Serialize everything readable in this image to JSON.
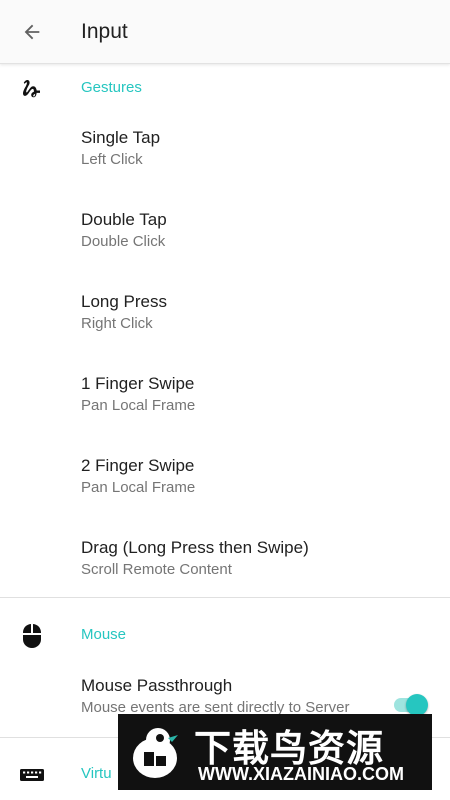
{
  "app_bar": {
    "title": "Input",
    "back_icon": "arrow-back-icon"
  },
  "sections": {
    "gestures": {
      "title": "Gestures",
      "icon": "gesture-icon",
      "items": [
        {
          "title": "Single Tap",
          "summary": "Left Click"
        },
        {
          "title": "Double Tap",
          "summary": "Double Click"
        },
        {
          "title": "Long Press",
          "summary": "Right Click"
        },
        {
          "title": "1 Finger Swipe",
          "summary": "Pan Local Frame"
        },
        {
          "title": "2 Finger Swipe",
          "summary": "Pan Local Frame"
        },
        {
          "title": "Drag (Long Press then Swipe)",
          "summary": "Scroll Remote Content"
        }
      ]
    },
    "mouse": {
      "title": "Mouse",
      "icon": "mouse-icon",
      "items": [
        {
          "title": "Mouse Passthrough",
          "summary": "Mouse events are sent directly to Server",
          "toggle_on": true
        }
      ]
    },
    "virtual_keyboard": {
      "title": "Virtu",
      "icon": "keyboard-icon"
    }
  },
  "colors": {
    "accent": "#26c6c0",
    "primary_text": "#212121",
    "secondary_text": "#757575"
  },
  "watermark": {
    "text": "下载鸟资源",
    "url": "WWW.XIAZAINIAO.COM"
  }
}
